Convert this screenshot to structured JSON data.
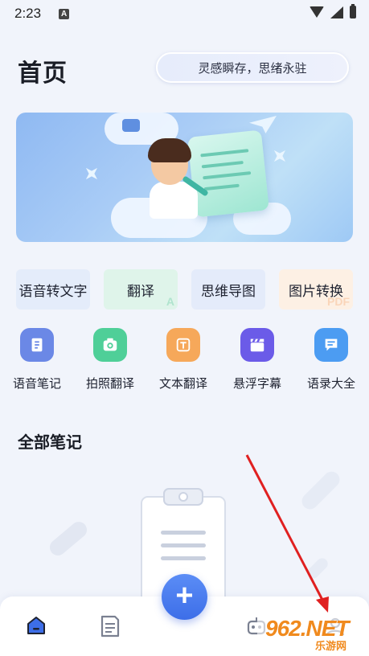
{
  "status_bar": {
    "time": "2:23",
    "notification_glyph": "A"
  },
  "header": {
    "title": "首页",
    "slogan": "灵感瞬存，思绪永驻"
  },
  "quick_actions": [
    {
      "label": "语音转文字",
      "corner": "",
      "color": "#6e8fd8"
    },
    {
      "label": "翻译",
      "corner": "A",
      "color": "#5ac79b"
    },
    {
      "label": "思维导图",
      "corner": "",
      "color": "#7b95d8"
    },
    {
      "label": "图片转换",
      "corner": "PDF",
      "color": "#f2a46b"
    }
  ],
  "tools": [
    {
      "label": "语音笔记",
      "icon": "voice-note-icon",
      "color": "#6b88e6"
    },
    {
      "label": "拍照翻译",
      "icon": "camera-icon",
      "color": "#4fcf98"
    },
    {
      "label": "文本翻译",
      "icon": "text-translate-icon",
      "color": "#f6a85a"
    },
    {
      "label": "悬浮字幕",
      "icon": "clapperboard-icon",
      "color": "#6b5be8"
    },
    {
      "label": "语录大全",
      "icon": "quote-message-icon",
      "color": "#4c9cf2"
    }
  ],
  "notes_section": {
    "title": "全部笔记"
  },
  "bottom_nav": {
    "items": [
      "home-icon",
      "notes-icon",
      "robot-icon",
      "profile-icon"
    ],
    "fab_symbol": "+",
    "active_color": "#3d6ee8"
  },
  "watermark": {
    "brand": "962.NET",
    "sub": "乐游网"
  }
}
